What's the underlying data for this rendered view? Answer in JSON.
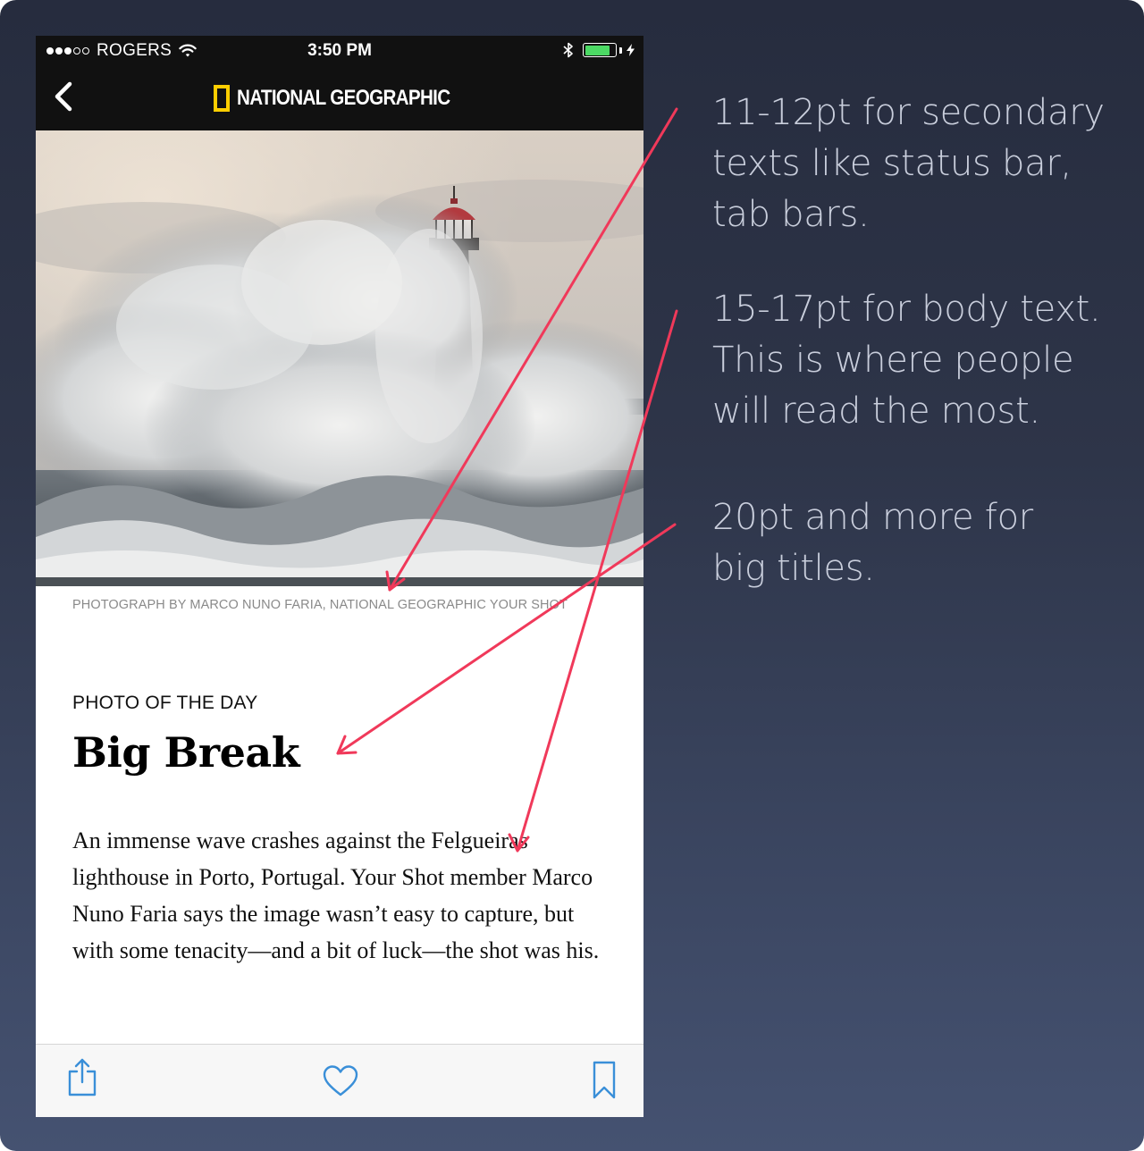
{
  "status_bar": {
    "carrier": "ROGERS",
    "time": "3:50 PM",
    "battery_level": 0.85,
    "signal_bars_total": 5,
    "signal_bars_filled": 3,
    "icons": [
      "wifi-icon",
      "bluetooth-icon",
      "battery-icon",
      "charging-bolt-icon"
    ]
  },
  "nav_bar": {
    "back_icon": "chevron-left-icon",
    "brand_name": "NATIONAL GEOGRAPHIC",
    "brand_color": "#ffce00"
  },
  "article": {
    "photo_description_icon": "photo",
    "caption": "PHOTOGRAPH BY MARCO NUNO FARIA, NATIONAL GEOGRAPHIC YOUR SHOT",
    "kicker": "PHOTO OF THE DAY",
    "title": "Big Break",
    "body": "An immense wave crashes against the Felgueiras lighthouse in Porto, Portugal. Your Shot member Marco Nuno Faria says the image wasn’t easy to capture, but with some tenacity—and a bit of luck—the shot was his."
  },
  "tab_bar": {
    "items": [
      {
        "icon": "share-icon"
      },
      {
        "icon": "heart-icon"
      },
      {
        "icon": "bookmark-icon"
      }
    ],
    "tint_color": "#3a8fd8"
  },
  "annotations": {
    "arrow_color": "#f0395a",
    "notes": [
      {
        "lines": [
          "11-12pt for secondary",
          "texts like status bar,",
          "tab bars."
        ]
      },
      {
        "lines": [
          "15-17pt for body text.",
          "This is where people",
          "will read the most."
        ]
      },
      {
        "lines": [
          "20pt and more for",
          "big titles."
        ]
      }
    ]
  }
}
